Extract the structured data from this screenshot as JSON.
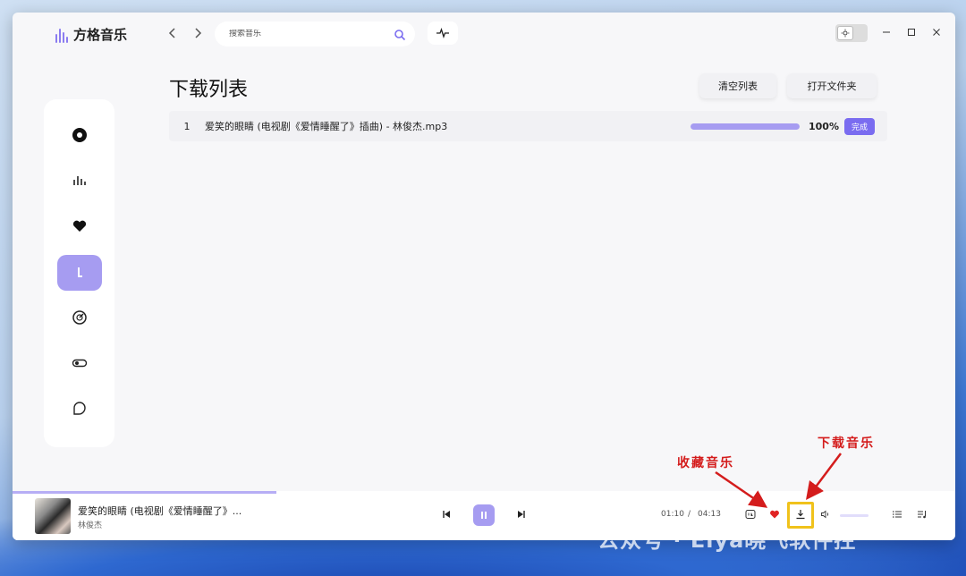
{
  "app": {
    "name": "方格音乐"
  },
  "search": {
    "placeholder": "搜索音乐"
  },
  "page": {
    "title": "下载列表",
    "clear_label": "清空列表",
    "open_folder_label": "打开文件夹"
  },
  "downloads": [
    {
      "index": "1",
      "name": "爱笑的眼睛 (电视剧《爱情睡醒了》插曲) - 林俊杰.mp3",
      "progress": 1.0,
      "percent": "100%",
      "status": "完成"
    }
  ],
  "sidebar": {
    "items": [
      {
        "icon": "disc-icon"
      },
      {
        "icon": "chart-icon"
      },
      {
        "icon": "heart-icon"
      },
      {
        "icon": "download-icon",
        "active": true
      },
      {
        "icon": "radar-icon"
      },
      {
        "icon": "toggle-icon"
      },
      {
        "icon": "leaf-icon"
      }
    ]
  },
  "player": {
    "title": "爱笑的眼睛 (电视剧《爱情睡醒了》...",
    "artist": "林俊杰",
    "current_time": "01:10",
    "separator": "/",
    "total_time": "04:13",
    "progress": 0.28
  },
  "annotations": {
    "favorite": "收藏音乐",
    "download": "下载音乐",
    "watermark": "公众号 · Eiya晓飞软件控"
  },
  "colors": {
    "accent": "#a69cf1",
    "badge": "#7a6cf0",
    "annotation": "#d41c1c",
    "highlight": "#f0c21b"
  }
}
